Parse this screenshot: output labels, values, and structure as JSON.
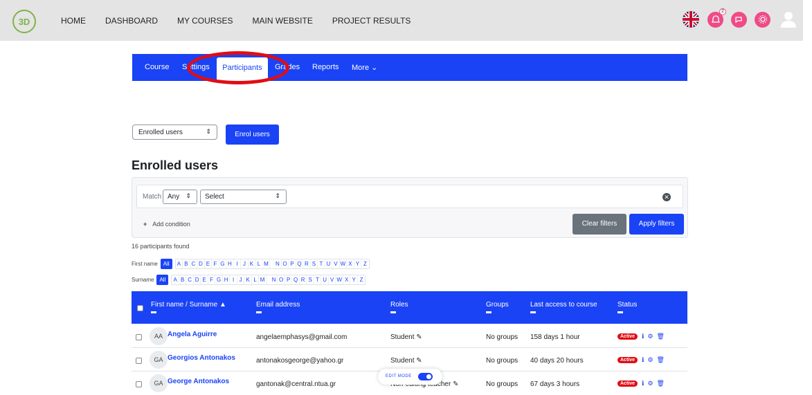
{
  "topbar": {
    "nav": [
      "HOME",
      "DASHBOARD",
      "MY COURSES",
      "MAIN WEBSITE",
      "PROJECT RESULTS"
    ],
    "notification_count": "2",
    "accent": "#ee4b87"
  },
  "coursenav": {
    "items": [
      "Course",
      "Settings",
      "Participants",
      "Grades",
      "Reports",
      "More"
    ],
    "active": "Participants"
  },
  "controls": {
    "selector": "Enrolled users",
    "enrol_button": "Enrol users"
  },
  "heading": "Enrolled users",
  "filter": {
    "match_label": "Match",
    "match_value": "Any",
    "select_value": "Select",
    "add_condition": "Add condition",
    "clear": "Clear filters",
    "apply": "Apply filters"
  },
  "found": "16 participants found",
  "alpha": {
    "firstname_label": "First name",
    "surname_label": "Surname",
    "all": "All",
    "letters": [
      "A",
      "B",
      "C",
      "D",
      "E",
      "F",
      "G",
      "H",
      "I",
      "J",
      "K",
      "L",
      "M",
      "N",
      "O",
      "P",
      "Q",
      "R",
      "S",
      "T",
      "U",
      "V",
      "W",
      "X",
      "Y",
      "Z"
    ]
  },
  "table": {
    "headers": [
      "First name / Surname",
      "Email address",
      "Roles",
      "Groups",
      "Last access to course",
      "Status"
    ],
    "rows": [
      {
        "initials": "AA",
        "name": "Angela Aguirre",
        "email": "angelaemphasys@gmail.com",
        "role": "Student",
        "groups": "No groups",
        "access": "158 days 1 hour",
        "status": "Active"
      },
      {
        "initials": "GA",
        "name": "Georgios Antonakos",
        "email": "antonakosgeorge@yahoo.gr",
        "role": "Student",
        "groups": "No groups",
        "access": "40 days 20 hours",
        "status": "Active"
      },
      {
        "initials": "GA",
        "name": "George Antonakos",
        "email": "gantonak@central.ntua.gr",
        "role": "Non-editing teacher",
        "groups": "No groups",
        "access": "67 days 3 hours",
        "status": "Active"
      }
    ]
  },
  "editmode": "EDIT MODE",
  "colors": {
    "primary": "#1a43f5",
    "danger": "#e10d14"
  }
}
